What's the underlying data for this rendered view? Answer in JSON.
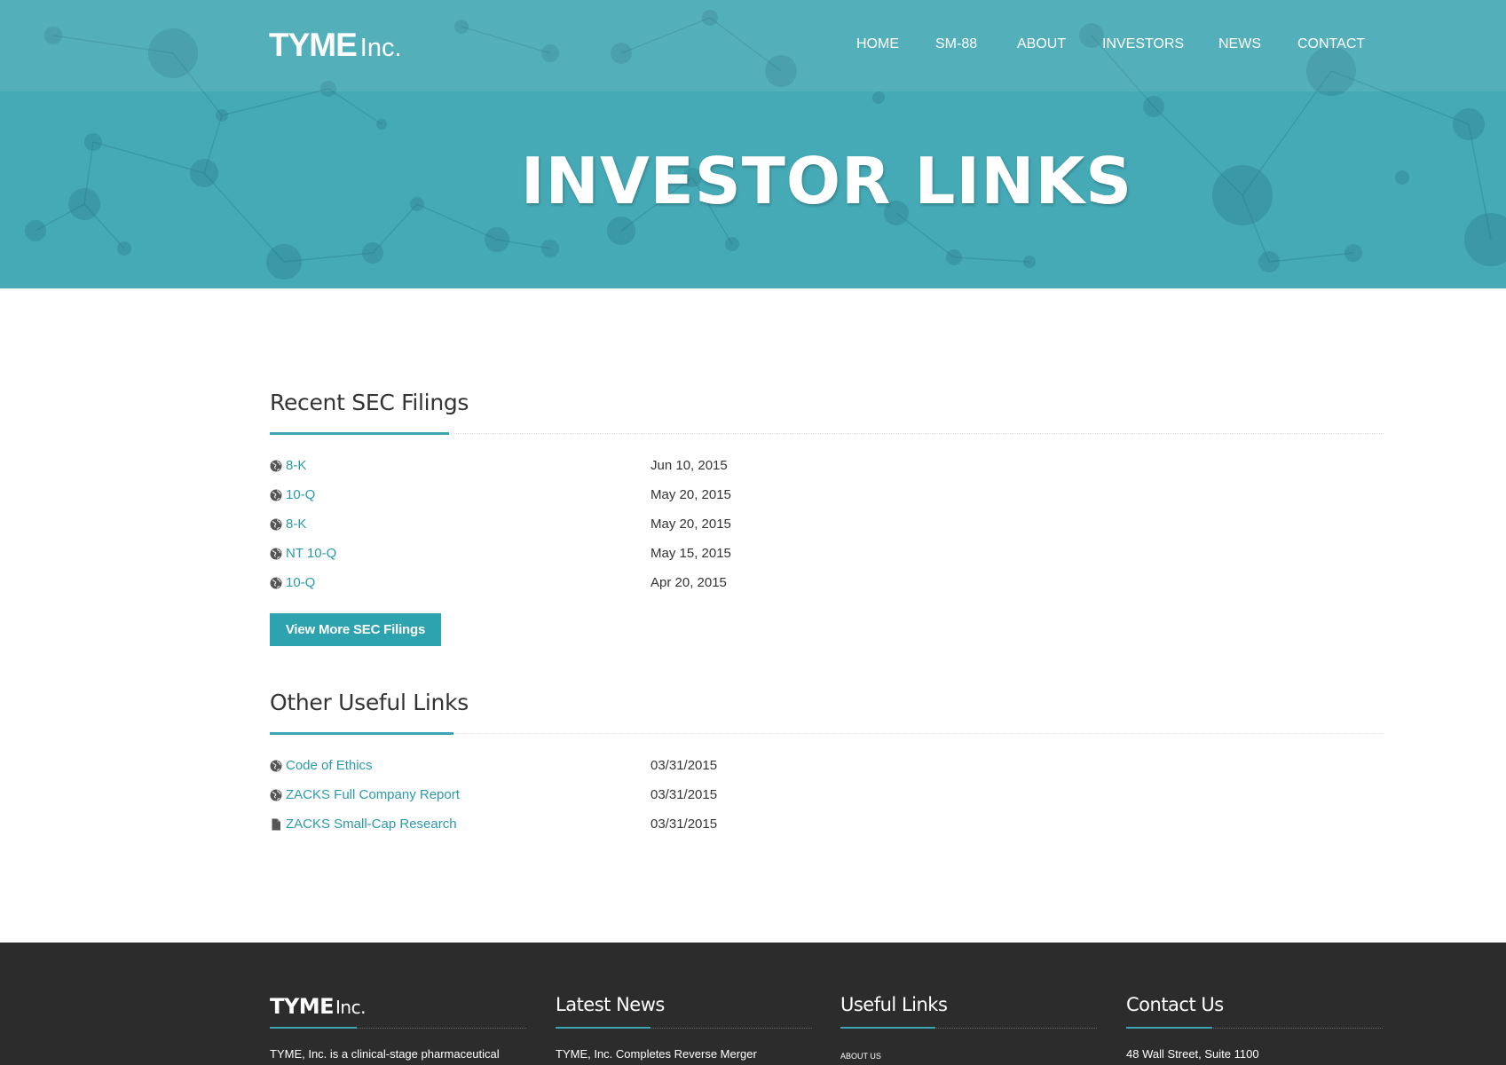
{
  "brand": {
    "name_bold": "TYME",
    "name_light": "Inc."
  },
  "nav": {
    "items": [
      {
        "label": "HOME"
      },
      {
        "label": "SM-88"
      },
      {
        "label": "ABOUT"
      },
      {
        "label": "INVESTORS"
      },
      {
        "label": "NEWS"
      },
      {
        "label": "CONTACT"
      }
    ]
  },
  "hero": {
    "title": "INVESTOR LINKS"
  },
  "sec_filings": {
    "heading": "Recent SEC Filings",
    "rows": [
      {
        "icon": "globe-icon",
        "label": "8-K",
        "date": "Jun 10, 2015"
      },
      {
        "icon": "globe-icon",
        "label": "10-Q",
        "date": "May 20, 2015"
      },
      {
        "icon": "globe-icon",
        "label": "8-K",
        "date": "May 20, 2015"
      },
      {
        "icon": "globe-icon",
        "label": "NT 10-Q",
        "date": "May 15, 2015"
      },
      {
        "icon": "globe-icon",
        "label": "10-Q",
        "date": "Apr 20, 2015"
      }
    ],
    "button_label": "View More SEC Filings"
  },
  "useful_links": {
    "heading": "Other Useful Links",
    "rows": [
      {
        "icon": "globe-icon",
        "label": "Code of Ethics",
        "date": "03/31/2015"
      },
      {
        "icon": "globe-icon",
        "label": "ZACKS Full Company Report",
        "date": "03/31/2015"
      },
      {
        "icon": "file-icon",
        "label": "ZACKS Small-Cap Research",
        "date": "03/31/2015"
      }
    ]
  },
  "footer": {
    "brand": {
      "name_bold": "TYME",
      "name_light": "Inc."
    },
    "brand_text": "TYME, Inc. is a clinical-stage pharmaceutical",
    "news": {
      "heading": "Latest News",
      "text": "TYME, Inc. Completes Reverse Merger"
    },
    "links": {
      "heading": "Useful Links",
      "text": "ABOUT US"
    },
    "contact": {
      "heading": "Contact Us",
      "text": "48 Wall Street, Suite 1100"
    }
  },
  "colors": {
    "hero_background": "#45aab6",
    "accent": "#2ea3b0",
    "link": "#2b9aa8",
    "footer_background": "#2c2c2c"
  }
}
